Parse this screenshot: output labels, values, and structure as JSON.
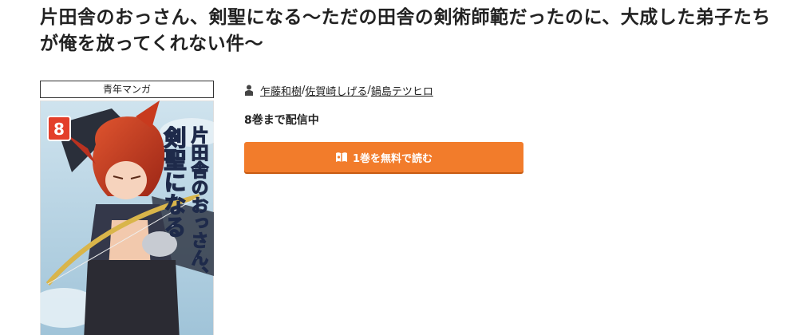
{
  "title": "片田舎のおっさん、剣聖になる～ただの田舎の剣術師範だったのに、大成した弟子たちが俺を放ってくれない件～",
  "genre": "青年マンガ",
  "authors": [
    "乍藤和樹",
    "佐賀崎しげる",
    "鍋島テツヒロ"
  ],
  "author_separator": "/",
  "status": "8巻まで配信中",
  "read_button": {
    "label": "1巻を無料で読む",
    "icon": "book-icon"
  },
  "cover": {
    "volume": "8",
    "title_lines": [
      "片田舎のおっさん、",
      "剣聖になる"
    ]
  },
  "colors": {
    "accent": "#f27c2b",
    "accent_shadow": "#c75b12",
    "text": "#222222"
  }
}
